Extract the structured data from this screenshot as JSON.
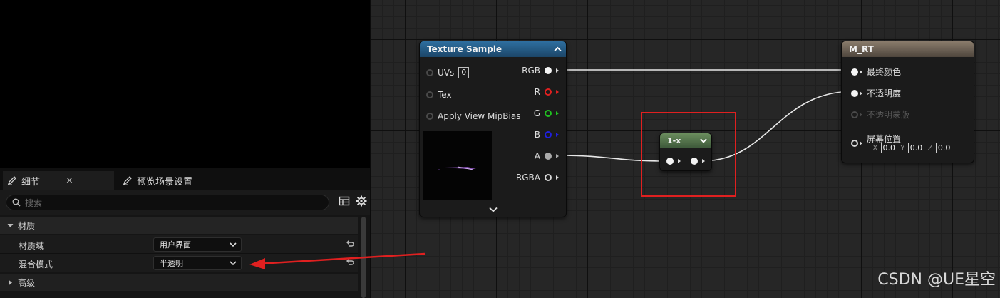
{
  "details_panel": {
    "tab_details": "细节",
    "tab_close": "×",
    "tab_preview": "预览场景设置",
    "search_placeholder": "搜索",
    "section_material": "材质",
    "props": [
      {
        "name": "材质域",
        "value": "用户界面"
      },
      {
        "name": "混合模式",
        "value": "半透明"
      }
    ],
    "section_advanced": "高级"
  },
  "texture_sample": {
    "title": "Texture Sample",
    "inputs": {
      "uvs": "UVs",
      "uvs_value": "0",
      "tex": "Tex",
      "mip": "Apply View MipBias"
    },
    "outputs": [
      "RGB",
      "R",
      "G",
      "B",
      "A",
      "RGBA"
    ],
    "output_colors": {
      "R": "#e02020",
      "G": "#20c020",
      "B": "#2020e0"
    }
  },
  "one_minus": {
    "title": "1-x"
  },
  "material_result": {
    "title": "M_RT",
    "pins": [
      "最终颜色",
      "不透明度",
      "不透明蒙版",
      "屏幕位置"
    ],
    "screen_pos": {
      "x_label": "X",
      "x": "0.0",
      "y_label": "Y",
      "y": "0.0",
      "z_label": "Z",
      "z": "0.0"
    }
  },
  "watermark": "CSDN @UE星空",
  "colors": {
    "highlight_box": "#e02020",
    "annotation_arrow": "#e02020"
  }
}
